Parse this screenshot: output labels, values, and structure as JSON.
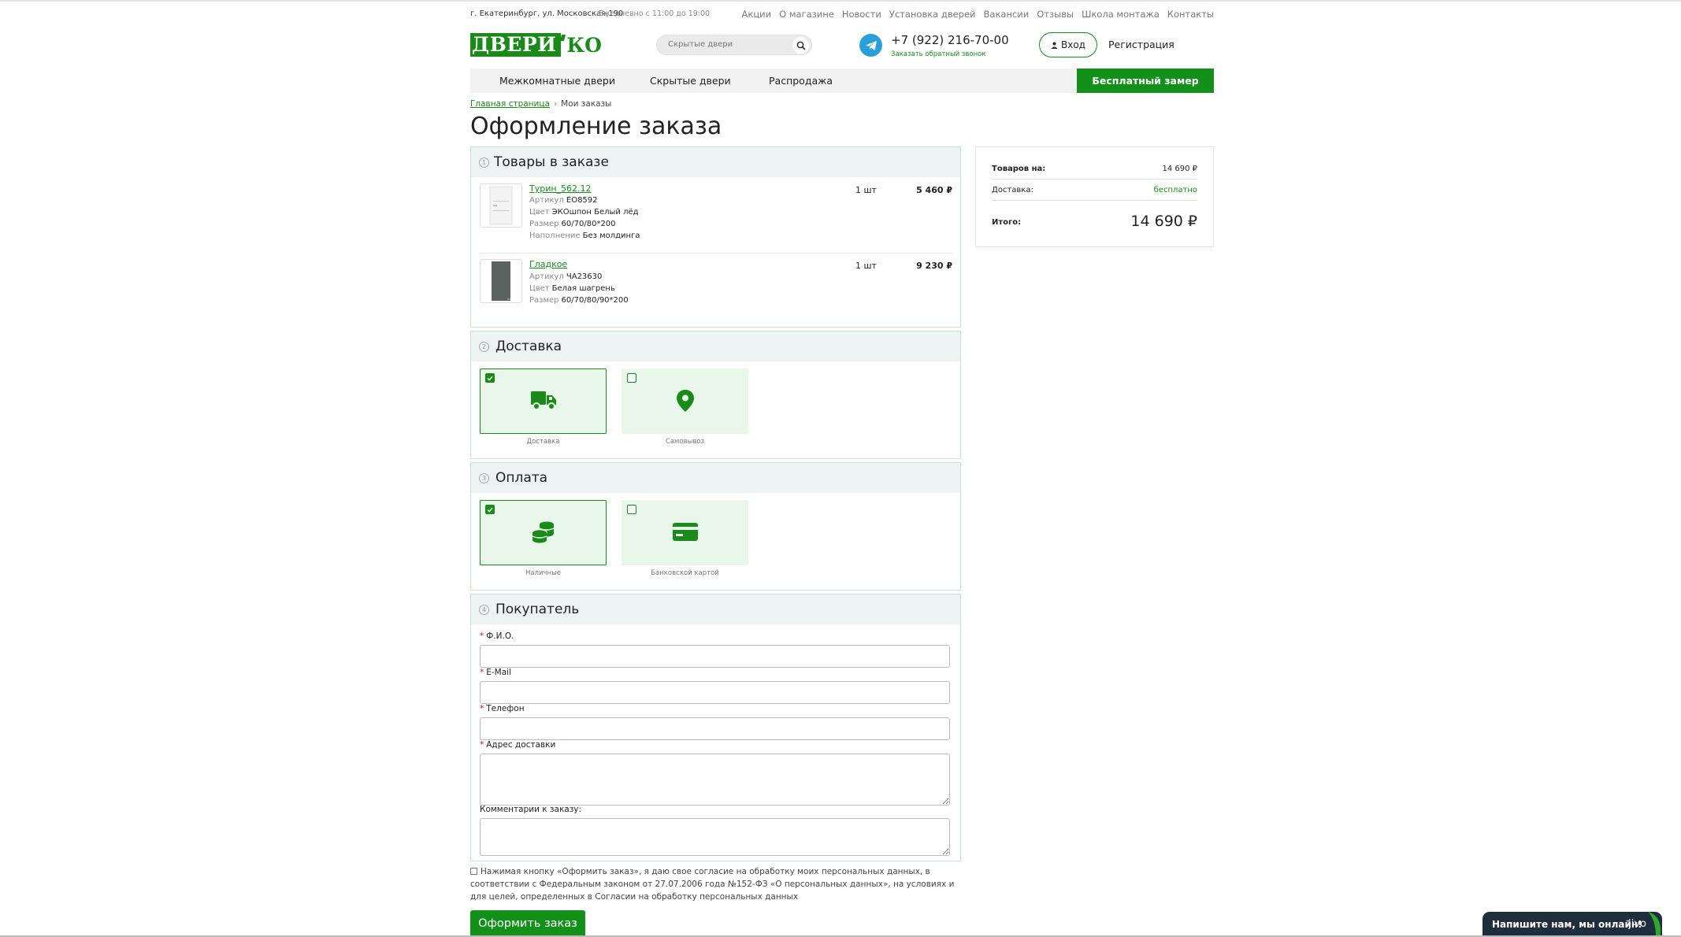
{
  "topbar": {
    "address": "г. Екатеринбург, ул. Московская,190",
    "hours": "Ежедневно с 11:00 до 19:00",
    "links": [
      "Акции",
      "О магазине",
      "Новости",
      "Установка дверей",
      "Вакансии",
      "Отзывы",
      "Школа монтажа",
      "Контакты"
    ]
  },
  "header": {
    "logo_left": "ДВЕРИ",
    "logo_right": "КО",
    "search_placeholder": "Скрытые двери",
    "phone": "+7 (922) 216-70-00",
    "callback": "Заказать обратный звонок",
    "login": "Вход",
    "register": "Регистрация"
  },
  "nav": {
    "items": [
      "Межкомнатные двери",
      "Скрытые двери",
      "Распродажа"
    ],
    "cta": "Бесплатный замер"
  },
  "breadcrumb": {
    "home": "Главная страница",
    "current": "Мои заказы"
  },
  "page_title": "Оформление заказа",
  "items_section": {
    "num": "1",
    "title": "Товары в заказе",
    "products": [
      {
        "name": "Турин_562.12",
        "qty": "1 шт",
        "price": "5 460 ₽",
        "attrs": [
          {
            "k": "Артикул",
            "v": "ЕО8592"
          },
          {
            "k": "Цвет",
            "v": "ЭКОшпон Белый лёд"
          },
          {
            "k": "Размер",
            "v": "60/70/80*200"
          },
          {
            "k": "Наполнение",
            "v": "Без молдинга"
          }
        ]
      },
      {
        "name": "Гладкое",
        "qty": "1 шт",
        "price": "9 230 ₽",
        "attrs": [
          {
            "k": "Артикул",
            "v": "ЧА23630"
          },
          {
            "k": "Цвет",
            "v": "Белая шагрень"
          },
          {
            "k": "Размер",
            "v": "60/70/80/90*200"
          }
        ]
      }
    ]
  },
  "delivery_section": {
    "num": "2",
    "title": "Доставка",
    "options": [
      {
        "label": "Доставка",
        "selected": true,
        "icon": "truck-icon"
      },
      {
        "label": "Самовывоз",
        "selected": false,
        "icon": "map-pin-icon"
      }
    ]
  },
  "payment_section": {
    "num": "3",
    "title": "Оплата",
    "options": [
      {
        "label": "Наличные",
        "selected": true,
        "icon": "coins-icon"
      },
      {
        "label": "Банковской картой",
        "selected": false,
        "icon": "credit-card-icon"
      }
    ]
  },
  "buyer_section": {
    "num": "4",
    "title": "Покупатель",
    "fields": [
      {
        "label": "Ф.И.О.",
        "required": true,
        "value": ""
      },
      {
        "label": "E-Mail",
        "required": true,
        "value": ""
      },
      {
        "label": "Телефон",
        "required": true,
        "value": ""
      },
      {
        "label": "Адрес доставки",
        "required": true,
        "value": ""
      },
      {
        "label": "Комментарии к заказу:",
        "required": false,
        "value": ""
      }
    ]
  },
  "consent_text": "Нажимая кнопку «Оформить заказ», я даю свое согласие на обработку моих персональных данных, в соответствии с Федеральным законом от 27.07.2006 года №152-ФЗ «О персональных данных», на условиях и для целей, определенных в Согласии на обработку персональных данных",
  "submit_label": "Оформить заказ",
  "summary": {
    "goods_label": "Товаров на:",
    "goods_value": "14 690 ₽",
    "delivery_label": "Доставка:",
    "delivery_value": "бесплатно",
    "total_label": "Итого:",
    "total_value": "14 690 ₽"
  },
  "chat": {
    "text": "Напишите нам, мы онлайн!",
    "brand": "jivo"
  },
  "colors": {
    "accent": "#1a8a1a",
    "section_border": "#c8e3d2",
    "option_bg": "#e9f6ea",
    "chat_bg": "#1f2d3d"
  }
}
